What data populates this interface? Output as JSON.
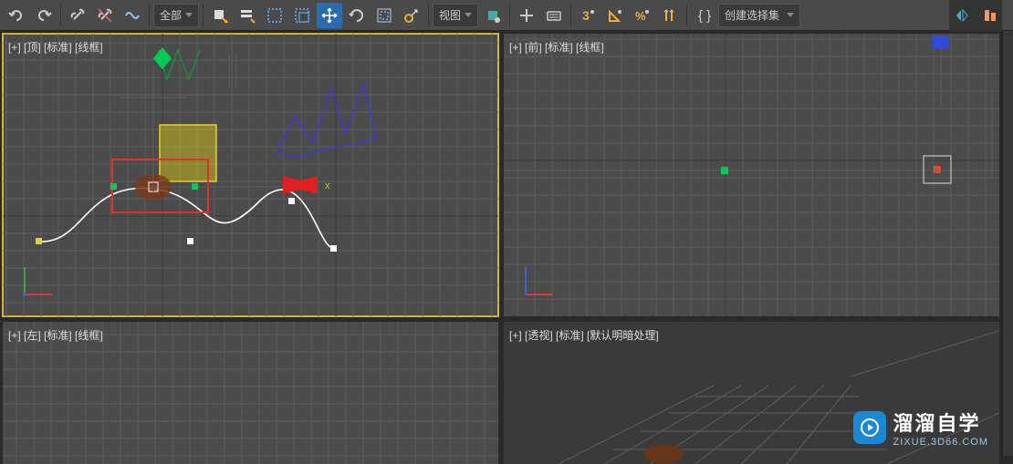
{
  "toolbar": {
    "dropdown_all": "全部",
    "dropdown_view": "视图",
    "dropdown_create_sel": "创建选择集"
  },
  "viewports": {
    "top": {
      "label": "[+] [顶] [标准] [线框]"
    },
    "front": {
      "label": "[+] [前] [标准] [线框]"
    },
    "left": {
      "label": "[+] [左] [标准] [线框]"
    },
    "persp": {
      "label": "[+] [透视] [标准] [默认明暗处理]"
    }
  },
  "watermark": {
    "title": "溜溜自学",
    "subtitle": "ZIXUE.3D66.COM"
  },
  "gizmo_axes": {
    "x": "x"
  },
  "icons": {
    "undo": "undo",
    "redo": "redo",
    "link": "link",
    "unlink": "unlink",
    "bind": "bind",
    "select": "select",
    "rect": "rect",
    "window": "window",
    "move": "move",
    "rotate": "rotate",
    "scale": "scale",
    "placement": "placement",
    "snap_toggle": "snap",
    "angle_snap": "angle",
    "percent": "percent",
    "spinner": "spinner",
    "curly": "curly",
    "mirror": "mirror",
    "align": "align",
    "layers": "layers",
    "three": "3",
    "curve": "curve",
    "arrow": "arrow"
  }
}
